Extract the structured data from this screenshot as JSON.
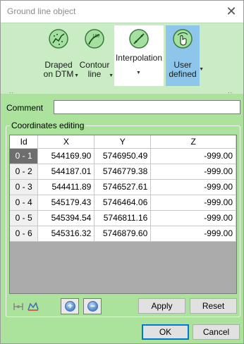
{
  "window": {
    "title": "Ground line object"
  },
  "ribbon": {
    "buttons": [
      {
        "label_line1": "Draped",
        "label_line2": "on DTM",
        "icon": "draped-icon"
      },
      {
        "label_line1": "Contour",
        "label_line2": "line",
        "icon": "contour-icon"
      },
      {
        "label_line1": "Interpolation",
        "label_line2": "",
        "icon": "interpolation-icon"
      },
      {
        "label_line1": "User",
        "label_line2": "defined",
        "icon": "user-defined-icon"
      }
    ]
  },
  "comment": {
    "label": "Comment",
    "value": ""
  },
  "coordinates": {
    "group_label": "Coordinates editing",
    "columns": [
      "Id",
      "X",
      "Y",
      "Z"
    ],
    "rows": [
      [
        "0 - 1",
        "544169.90",
        "5746950.49",
        "-999.00"
      ],
      [
        "0 - 2",
        "544187.01",
        "5746779.38",
        "-999.00"
      ],
      [
        "0 - 3",
        "544411.89",
        "5746527.61",
        "-999.00"
      ],
      [
        "0 - 4",
        "545179.43",
        "5746464.06",
        "-999.00"
      ],
      [
        "0 - 5",
        "545394.54",
        "5746811.16",
        "-999.00"
      ],
      [
        "0 - 6",
        "545316.32",
        "5746879.60",
        "-999.00"
      ]
    ],
    "selected_row": 0
  },
  "actions": {
    "apply_label": "Apply",
    "reset_label": "Reset",
    "add_symbol": "+",
    "remove_symbol": "−"
  },
  "footer": {
    "ok_label": "OK",
    "cancel_label": "Cancel"
  },
  "colors": {
    "ribbon_bg": "#c9ecc4",
    "main_bg": "#abe29c",
    "selected_button_bg": "#8dc6ea",
    "grid_bg": "#ababab"
  }
}
